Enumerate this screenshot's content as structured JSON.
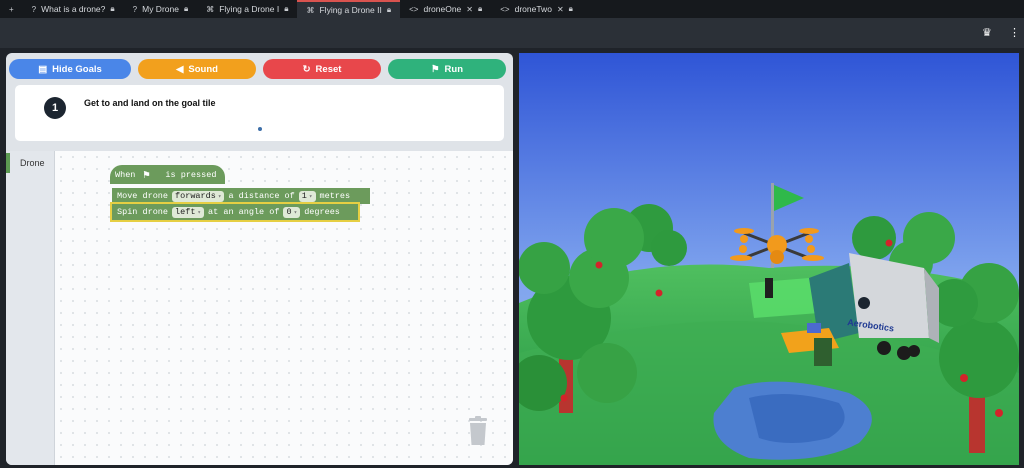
{
  "tabs": [
    {
      "icon": "plus-icon",
      "label": ""
    },
    {
      "icon": "question-circle-icon",
      "label": "What is a drone?",
      "status_icon": "lock-icon"
    },
    {
      "icon": "question-circle-icon",
      "label": "My Drone",
      "status_icon": "lock-icon"
    },
    {
      "icon": "drone-icon",
      "label": "Flying a Drone I",
      "status_icon": "lock-icon"
    },
    {
      "icon": "drone-icon",
      "label": "Flying a Drone II",
      "status_icon": "lock-icon",
      "active": true
    },
    {
      "icon": "code-icon",
      "label": "droneOne",
      "status_icon": "lock-icon"
    },
    {
      "icon": "code-icon",
      "label": "droneTwo",
      "status_icon": "lock-icon"
    }
  ],
  "buttons": {
    "hide_goals": "Hide Goals",
    "sound": "Sound",
    "reset": "Reset",
    "run": "Run"
  },
  "goal": {
    "number": "1",
    "text": "Get to and land on the goal tile"
  },
  "categories": [
    "Drone"
  ],
  "blocks": {
    "when": "When",
    "is_pressed": "is pressed",
    "move_prefix": "Move drone",
    "move_direction": "forwards",
    "move_mid": "a distance of",
    "move_value": "1",
    "move_suffix": "metres",
    "spin_prefix": "Spin drone",
    "spin_direction": "left",
    "spin_mid": "at an angle of",
    "spin_value": "0",
    "spin_suffix": "degrees"
  },
  "scene": {
    "truck_brand": "Aerobotics"
  },
  "colors": {
    "hide_goals": "#4a86e8",
    "sound": "#f2a01d",
    "reset": "#e8474b",
    "run": "#2fb27c",
    "block_green": "#6c9b5c",
    "active_tab_accent": "#d9534f"
  }
}
